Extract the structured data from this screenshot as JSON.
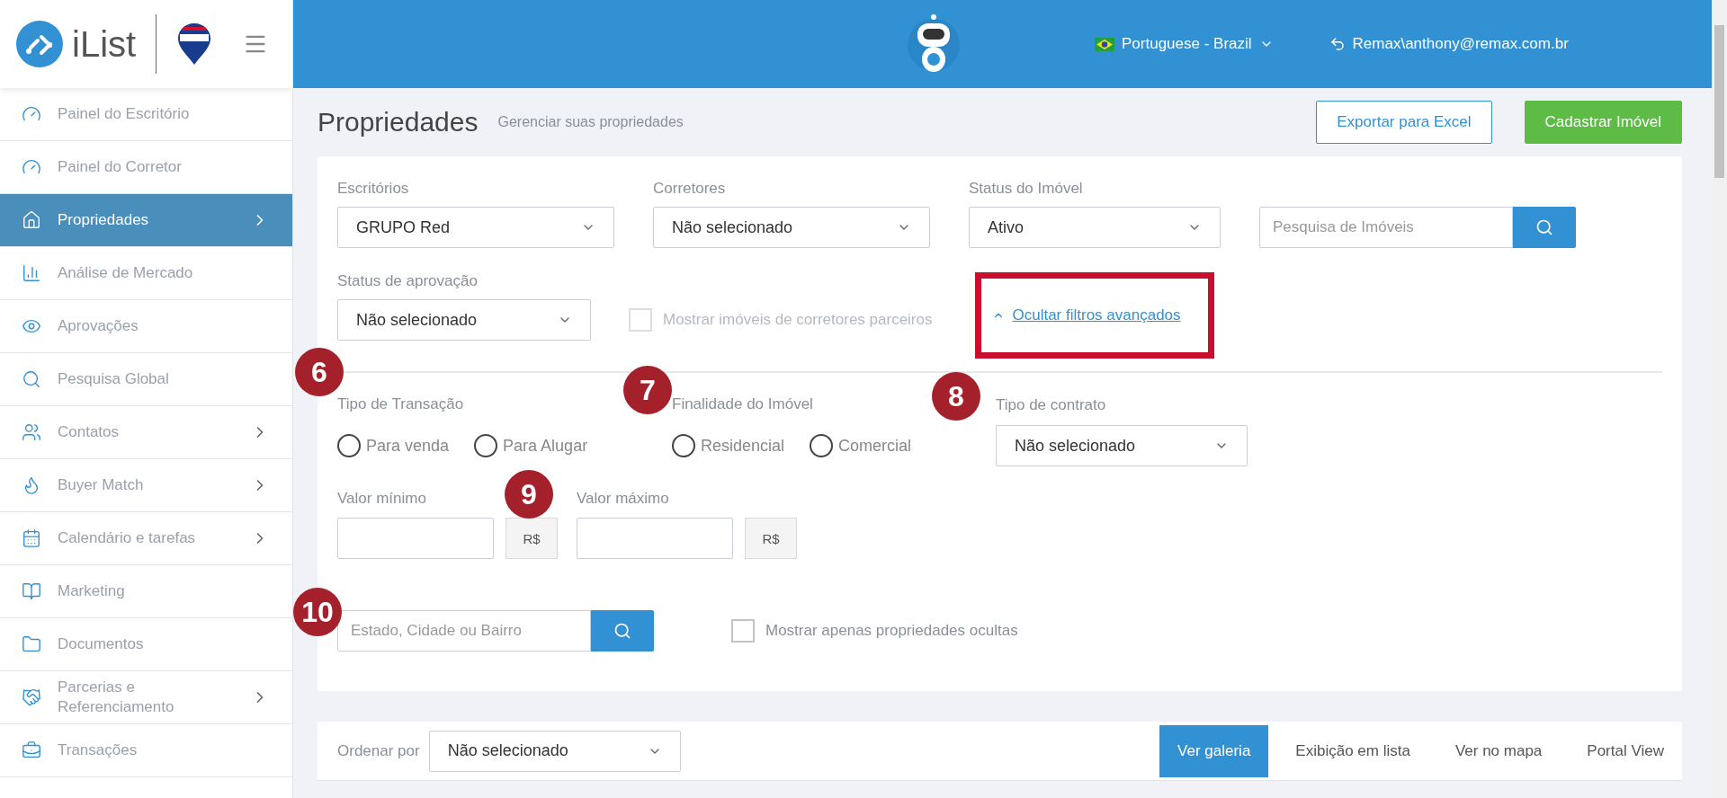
{
  "sidebar": {
    "logo_text": "iList",
    "items": [
      {
        "label": "Painel do Escritório",
        "selected": false,
        "expandable": false
      },
      {
        "label": "Painel do Corretor",
        "selected": false,
        "expandable": false
      },
      {
        "label": "Propriedades",
        "selected": true,
        "expandable": true
      },
      {
        "label": "Análise de Mercado",
        "selected": false,
        "expandable": false
      },
      {
        "label": "Aprovações",
        "selected": false,
        "expandable": false
      },
      {
        "label": "Pesquisa Global",
        "selected": false,
        "expandable": false
      },
      {
        "label": "Contatos",
        "selected": false,
        "expandable": true
      },
      {
        "label": "Buyer Match",
        "selected": false,
        "expandable": true
      },
      {
        "label": "Calendário e tarefas",
        "selected": false,
        "expandable": true
      },
      {
        "label": "Marketing",
        "selected": false,
        "expandable": false
      },
      {
        "label": "Documentos",
        "selected": false,
        "expandable": false
      },
      {
        "label": "Parcerias e Referenciamento",
        "selected": false,
        "expandable": true
      },
      {
        "label": "Transações",
        "selected": false,
        "expandable": false
      }
    ]
  },
  "header": {
    "language": "Portuguese - Brazil",
    "user": "Remax\\anthony@remax.com.br"
  },
  "page": {
    "title": "Propriedades",
    "subtitle": "Gerenciar suas propriedades",
    "buttons": [
      {
        "label": "Exportar para Excel",
        "kind": "outline"
      },
      {
        "label": "Cadastrar Imóvel",
        "kind": "primary"
      }
    ]
  },
  "filters": {
    "row1": [
      {
        "label": "Escritórios",
        "value": "GRUPO Red"
      },
      {
        "label": "Corretores",
        "value": "Não selecionado"
      },
      {
        "label": "Status do Imóvel",
        "value": "Ativo"
      }
    ],
    "property_search": {
      "placeholder": "Pesquisa de Imóveis"
    },
    "approval_status": {
      "label": "Status de aprovação",
      "value": "Não selecionado"
    },
    "partner_checkbox": {
      "label": "Mostrar imóveis de corretores parceiros",
      "checked": false,
      "disabled": true
    },
    "advanced_toggle": {
      "label": "Ocultar filtros avançados",
      "expanded": true
    },
    "transaction_type": {
      "label": "Tipo de Transação",
      "options": [
        {
          "label": "Para venda",
          "selected": false
        },
        {
          "label": "Para Alugar",
          "selected": false
        }
      ]
    },
    "purpose": {
      "label": "Finalidade do Imóvel",
      "options": [
        {
          "label": "Residencial",
          "selected": false
        },
        {
          "label": "Comercial",
          "selected": false
        }
      ]
    },
    "contract_type": {
      "label": "Tipo de contrato",
      "value": "Não selecionado"
    },
    "min_value": {
      "label": "Valor mínimo",
      "addon": "R$"
    },
    "max_value": {
      "label": "Valor máximo",
      "addon": "R$"
    },
    "location_search": {
      "placeholder": "Estado, Cidade ou Bairro"
    },
    "hidden_checkbox": {
      "label": "Mostrar apenas propriedades ocultas",
      "checked": false
    }
  },
  "results_bar": {
    "sort_label": "Ordenar por",
    "sort_value": "Não selecionado",
    "views": [
      {
        "label": "Ver galeria",
        "selected": true
      },
      {
        "label": "Exibição em lista",
        "selected": false
      },
      {
        "label": "Ver no mapa",
        "selected": false
      },
      {
        "label": "Portal View",
        "selected": false
      }
    ]
  },
  "annotations": [
    {
      "label": "6"
    },
    {
      "label": "7"
    },
    {
      "label": "8"
    },
    {
      "label": "9"
    },
    {
      "label": "10"
    }
  ]
}
